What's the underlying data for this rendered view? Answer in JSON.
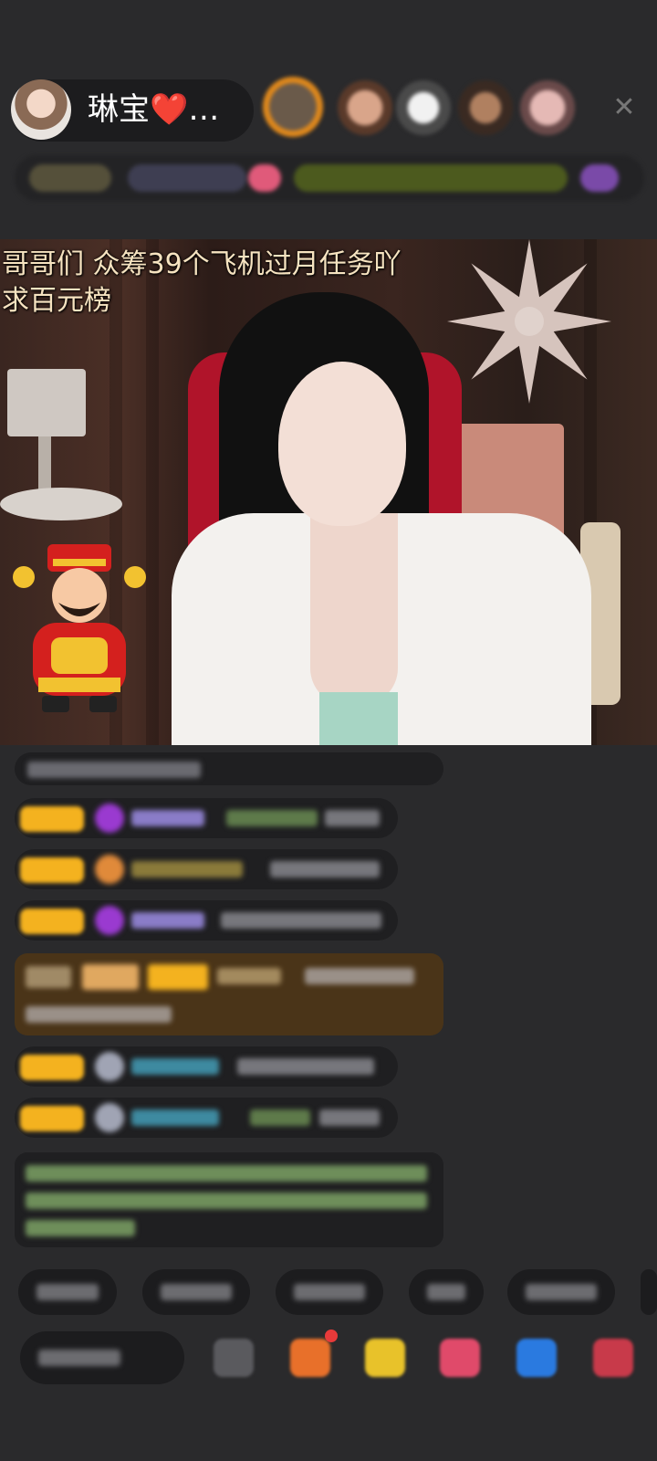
{
  "header": {
    "host_name": "琳宝❤️…",
    "close_icon": "close-icon"
  },
  "video": {
    "caption_line1": "哥哥们 众筹39个飞机过月任务吖",
    "caption_line2": "求百元榜"
  },
  "colors": {
    "background": "#2a2a2c",
    "caption": "#f6e3c0",
    "level_badge": "#f4b21f",
    "highlight_message_bg": "#4a3418"
  }
}
